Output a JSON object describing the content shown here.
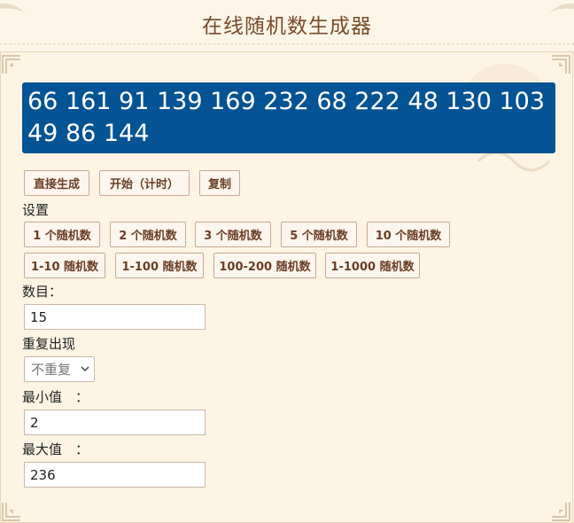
{
  "header": {
    "title": "在线随机数生成器"
  },
  "result": {
    "text": "66 161 91 139 169 232 68 222 48 130 103 49 86 144"
  },
  "actions": {
    "generate": "直接生成",
    "start_timed": "开始（计时）",
    "copy": "复制"
  },
  "settings": {
    "label": "设置",
    "presets_row1": [
      "1 个随机数",
      "2 个随机数",
      "3 个随机数",
      "5 个随机数",
      "10 个随机数"
    ],
    "presets_row2": [
      "1-10 随机数",
      "1-100 随机数",
      "100-200 随机数",
      "1-1000 随机数"
    ]
  },
  "form": {
    "count_label": "数目：",
    "count_value": "15",
    "repeat_label": "重复出现",
    "repeat_value": "不重复",
    "min_label": "最小值　：",
    "min_value": "2",
    "max_label": "最大值　：",
    "max_value": "236"
  },
  "colors": {
    "result_bg": "#045395",
    "button_text": "#6b3d24",
    "title_text": "#7a4a2a"
  }
}
